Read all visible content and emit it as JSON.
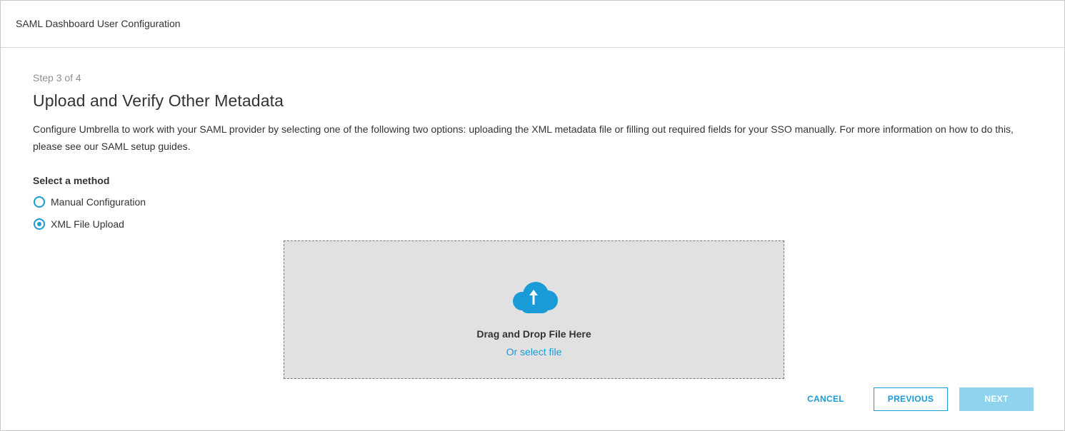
{
  "dialog": {
    "title": "SAML Dashboard User Configuration"
  },
  "wizard": {
    "step_text": "Step 3 of 4",
    "heading": "Upload and Verify Other Metadata",
    "description": "Configure Umbrella to work with your SAML provider by selecting one of the following two options: uploading the XML metadata file or filling out required fields for your SSO manually. For more information on how to do this, please see our SAML setup guides."
  },
  "method": {
    "label": "Select a method",
    "options": [
      {
        "label": "Manual Configuration",
        "selected": false
      },
      {
        "label": "XML File Upload",
        "selected": true
      }
    ]
  },
  "upload": {
    "icon": "cloud-upload-icon",
    "drop_text": "Drag and Drop File Here",
    "select_text": "Or select file"
  },
  "buttons": {
    "cancel": "CANCEL",
    "previous": "PREVIOUS",
    "next": "NEXT"
  },
  "colors": {
    "accent": "#1a9bd7",
    "disabled_button": "#8fd3ee",
    "dropzone_bg": "#e1e1e1"
  }
}
